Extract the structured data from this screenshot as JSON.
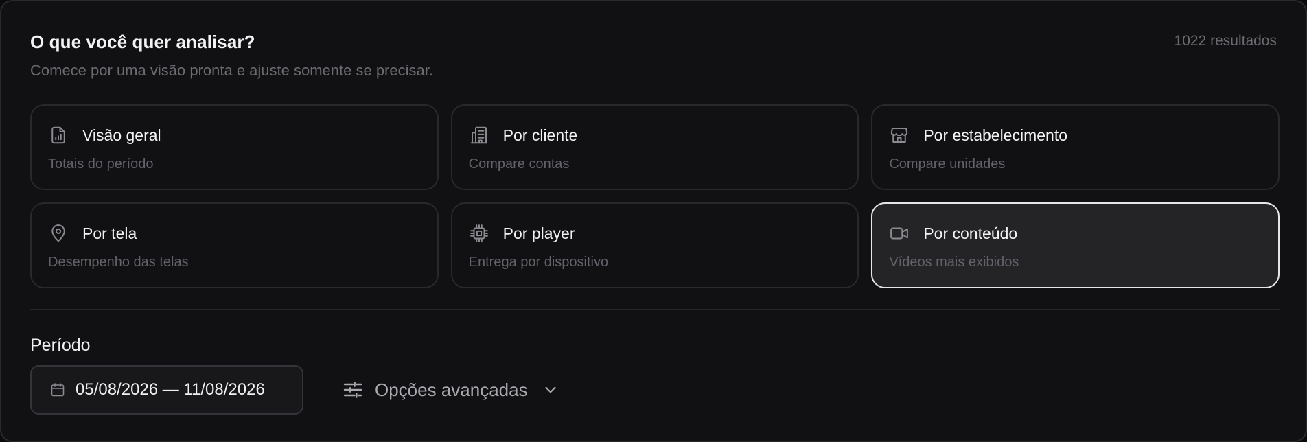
{
  "header": {
    "title": "O que você quer analisar?",
    "subtitle": "Comece por uma visão pronta e ajuste somente se precisar.",
    "results": "1022 resultados"
  },
  "views": [
    {
      "title": "Visão geral",
      "desc": "Totais do período",
      "icon": "report-chart-icon",
      "selected": false
    },
    {
      "title": "Por cliente",
      "desc": "Compare contas",
      "icon": "building-icon",
      "selected": false
    },
    {
      "title": "Por estabelecimento",
      "desc": "Compare unidades",
      "icon": "store-icon",
      "selected": false
    },
    {
      "title": "Por tela",
      "desc": "Desempenho das telas",
      "icon": "map-pin-icon",
      "selected": false
    },
    {
      "title": "Por player",
      "desc": "Entrega por dispositivo",
      "icon": "cpu-chip-icon",
      "selected": false
    },
    {
      "title": "Por conteúdo",
      "desc": "Vídeos mais exibidos",
      "icon": "video-camera-icon",
      "selected": true
    }
  ],
  "period": {
    "label": "Período",
    "range": "05/08/2026 — 11/08/2026"
  },
  "advanced": {
    "label": "Opções avançadas"
  }
}
